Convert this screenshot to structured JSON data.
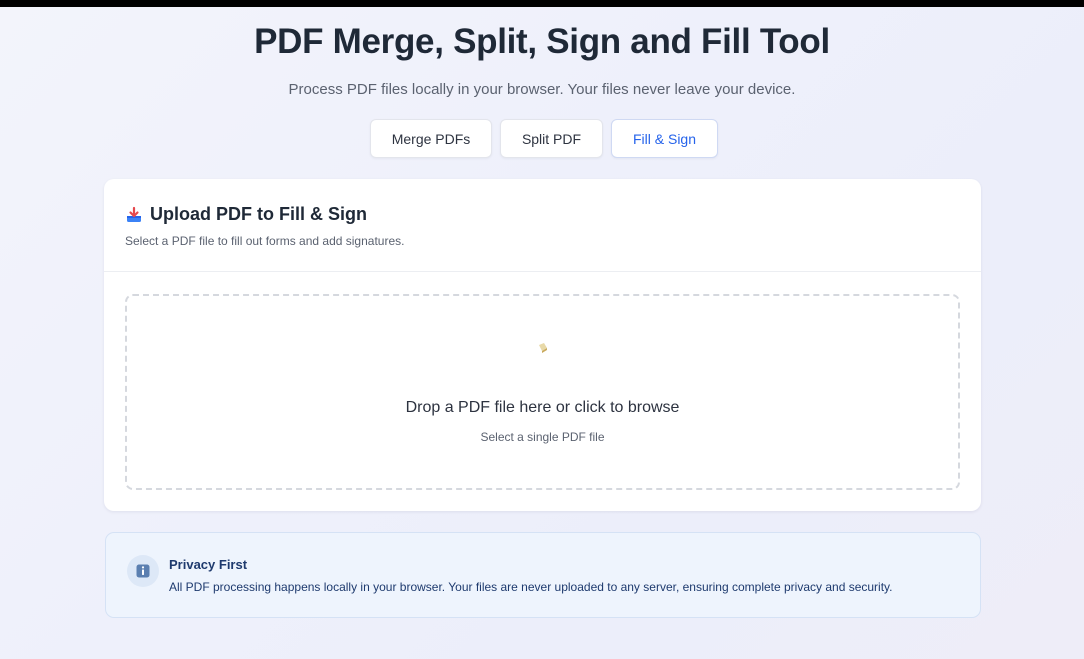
{
  "header": {
    "title": "PDF Merge, Split, Sign and Fill Tool",
    "subtitle": "Process PDF files locally in your browser. Your files never leave your device."
  },
  "tabs": [
    {
      "label": "Merge PDFs",
      "active": false
    },
    {
      "label": "Split PDF",
      "active": false
    },
    {
      "label": "Fill & Sign",
      "active": true
    }
  ],
  "upload_card": {
    "icon": "inbox-tray-icon",
    "title": "Upload PDF to Fill & Sign",
    "description": "Select a PDF file to fill out forms and add signatures.",
    "dropzone": {
      "icon": "file-icon",
      "title": "Drop a PDF file here or click to browse",
      "subtitle": "Select a single PDF file"
    }
  },
  "privacy": {
    "icon": "info-icon",
    "title": "Privacy First",
    "text": "All PDF processing happens locally in your browser. Your files are never uploaded to any server, ensuring complete privacy and security."
  },
  "colors": {
    "accent": "#2563eb",
    "title_text": "#1f2937",
    "privacy_bg": "#eef4fd",
    "privacy_text": "#1e3a6e"
  }
}
